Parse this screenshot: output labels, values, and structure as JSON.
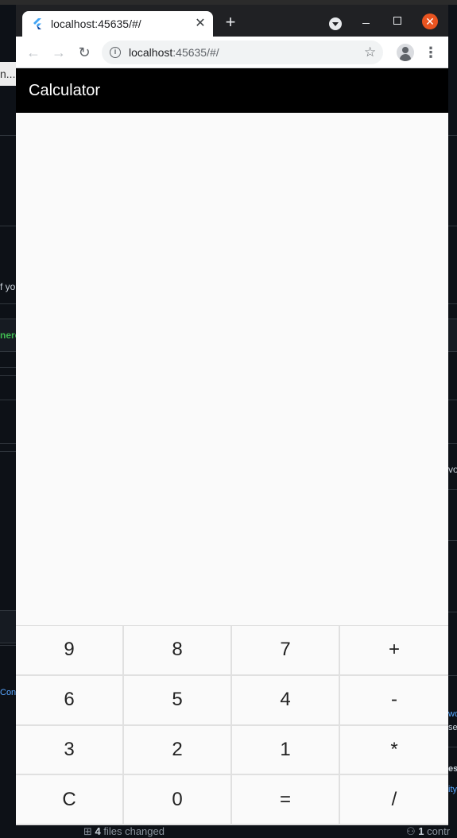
{
  "background": {
    "left_fragments": [
      "n...",
      "f yo",
      "nerc",
      "Con"
    ],
    "right_fragments": [
      "vo",
      "wo",
      "se",
      "es",
      "ity"
    ],
    "bottom_bar": {
      "files_count": "4",
      "files_text": " files changed",
      "contributors_count": "1",
      "contributors_text": " contr"
    }
  },
  "browser": {
    "tab_title": "localhost:45635/#/",
    "url_host": "localhost",
    "url_rest": ":45635/#/",
    "icons": {
      "favicon": "flutter-icon",
      "back": "arrow-left-icon",
      "forward": "arrow-right-icon",
      "reload": "reload-icon",
      "info": "info-icon",
      "bookmark": "star-icon",
      "profile": "avatar-icon",
      "menu": "kebab-menu-icon",
      "new_tab": "plus-icon",
      "close": "close-icon"
    },
    "colors": {
      "tab_strip": "#202124",
      "close_button": "#e95420"
    }
  },
  "app": {
    "title": "Calculator",
    "display_value": "",
    "appbar_color": "#000000",
    "keys": [
      [
        "9",
        "8",
        "7",
        "+"
      ],
      [
        "6",
        "5",
        "4",
        "-"
      ],
      [
        "3",
        "2",
        "1",
        "*"
      ],
      [
        "C",
        "0",
        "=",
        "/"
      ]
    ]
  }
}
